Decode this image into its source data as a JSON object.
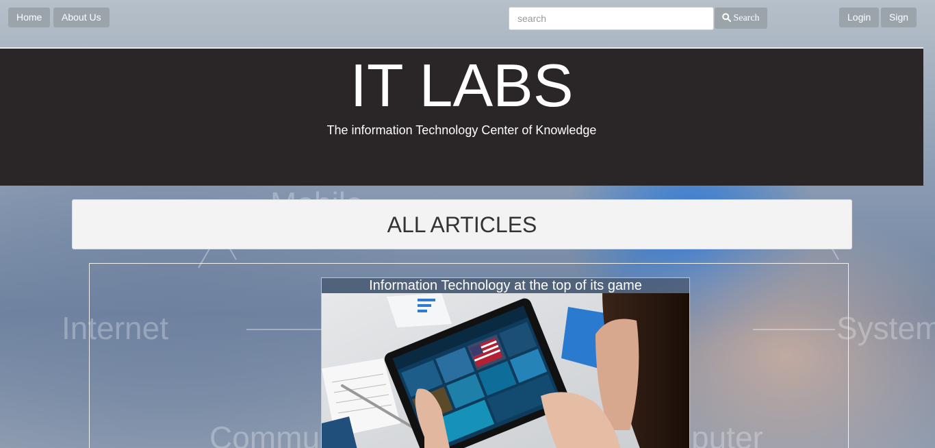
{
  "nav": {
    "home_label": "Home",
    "about_label": "About Us",
    "search_placeholder": "search",
    "search_button_label": "Search",
    "login_label": "Login",
    "sign_label": "Sign"
  },
  "header": {
    "title": "IT LABS",
    "tagline": "The information Technology Center of Knowledge"
  },
  "articles": {
    "section_title": "ALL ARTICLES",
    "items": [
      {
        "title": "Information Technology at the top of its game"
      }
    ]
  },
  "background": {
    "words": [
      "Mobile",
      "Internet",
      "System",
      "Commun",
      "puter"
    ]
  },
  "colors": {
    "banner": "#2a2526",
    "nav_button": "#96a0a5",
    "panel": "#f3f3f3"
  }
}
